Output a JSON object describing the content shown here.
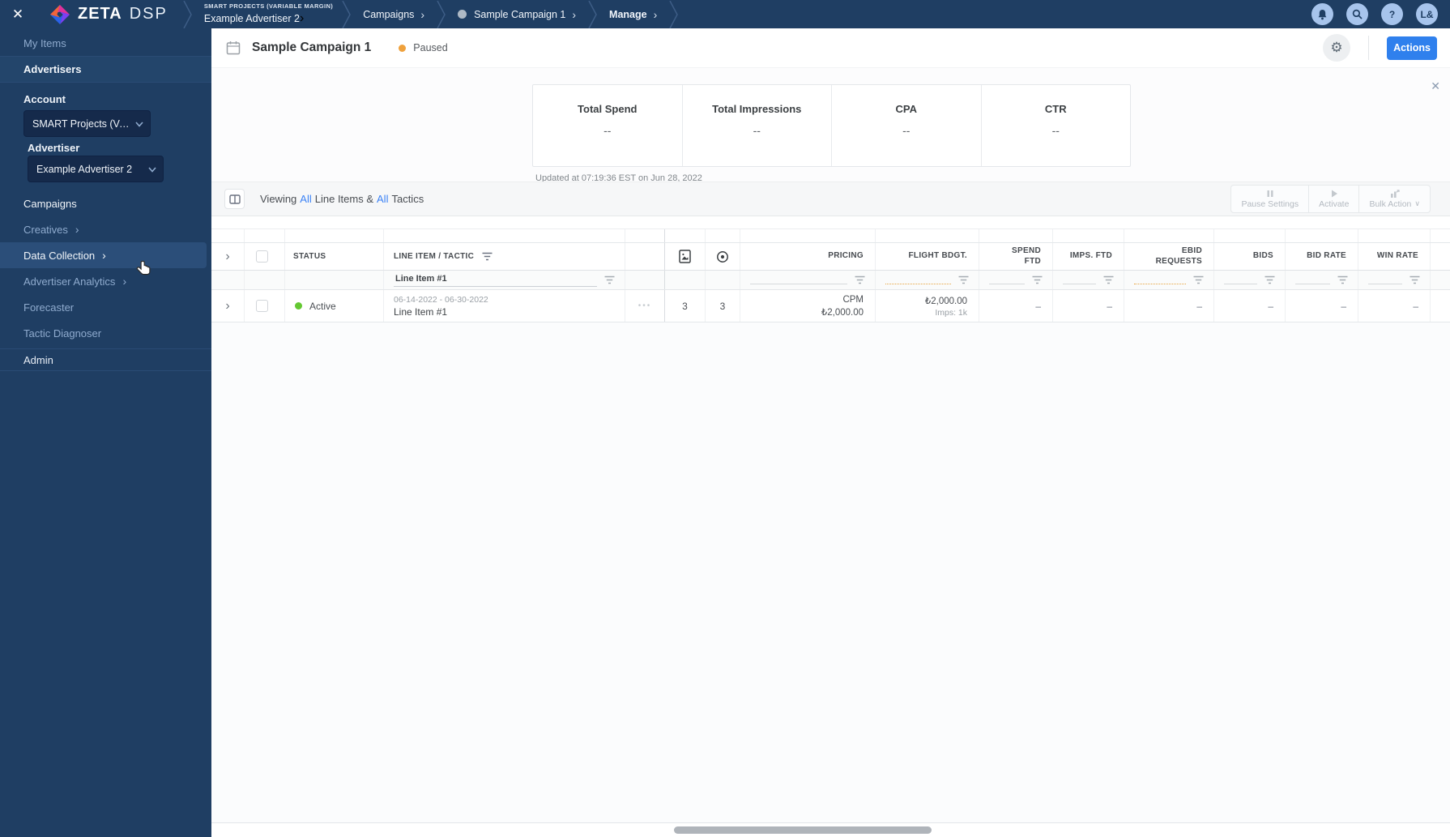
{
  "app": {
    "name_primary": "ZETA",
    "name_secondary": "DSP"
  },
  "topbar": {
    "breadcrumb": {
      "account_eyebrow": "SMART PROJECTS (VARIABLE MARGIN)",
      "advertiser": "Example Advertiser 2",
      "campaigns": "Campaigns",
      "campaign": "Sample Campaign 1",
      "manage": "Manage"
    },
    "avatar_initials": "L&"
  },
  "sidebar": {
    "my_items": "My Items",
    "advertisers": "Advertisers",
    "account_label": "Account",
    "account_value": "SMART Projects (Variable Margin)",
    "advertiser_label": "Advertiser",
    "advertiser_value": "Example Advertiser 2",
    "nav": [
      {
        "label": "Campaigns"
      },
      {
        "label": "Creatives"
      },
      {
        "label": "Data Collection"
      },
      {
        "label": "Advertiser Analytics"
      },
      {
        "label": "Forecaster"
      },
      {
        "label": "Tactic Diagnoser"
      }
    ],
    "admin": "Admin"
  },
  "header": {
    "title": "Sample Campaign 1",
    "status": "Paused",
    "actions_label": "Actions"
  },
  "stats": {
    "cards": [
      {
        "label": "Total Spend",
        "value": "--"
      },
      {
        "label": "Total Impressions",
        "value": "--"
      },
      {
        "label": "CPA",
        "value": "--"
      },
      {
        "label": "CTR",
        "value": "--"
      }
    ],
    "updated": "Updated at 07:19:36 EST on Jun 28, 2022"
  },
  "toolbar": {
    "viewing_1": "Viewing",
    "all_1": "All",
    "viewing_2": "Line Items &",
    "all_2": "All",
    "viewing_3": "Tactics",
    "pause_settings": "Pause Settings",
    "activate": "Activate",
    "bulk_action": "Bulk Action"
  },
  "table": {
    "headers": {
      "status": "STATUS",
      "line_item": "LINE ITEM / TACTIC",
      "pricing": "PRICING",
      "flight": "FLIGHT BDGT.",
      "spend_ftd": "SPEND\nFTD",
      "imps_ftd": "IMPS. FTD",
      "ebid": "EBID\nREQUESTS",
      "bids": "BIDS",
      "bid_rate": "BID RATE",
      "win_rate": "WIN RATE"
    },
    "filters": {
      "line_item_value": "Line Item #1"
    },
    "row": {
      "status": "Active",
      "dates": "06-14-2022 - 06-30-2022",
      "name": "Line Item #1",
      "creatives_count": "3",
      "tactics_count": "3",
      "pricing_type": "CPM",
      "pricing_value": "₺2,000.00",
      "flight_budget": "₺2,000.00",
      "flight_imps": "Imps: 1k",
      "dash": "–"
    }
  },
  "icons": {
    "close-icon": "✕",
    "bell-icon": "bell",
    "search-icon": "magnifier",
    "help-icon": "?",
    "gear-icon": "gear",
    "calendar-icon": "calendar",
    "columns-icon": "column-toggle",
    "filter-icon": "filter-lines",
    "creative-icon": "image-file",
    "tactic-icon": "target",
    "pause-icon": "pause-bars",
    "play-icon": "play-triangle",
    "bulk-icon": "bulk-chart"
  },
  "colors": {
    "navy": "#1F3E63",
    "accent": "#2F80ED",
    "paused_dot": "#EFA13C",
    "active_dot": "#64C832",
    "link_blue": "#3B82F6"
  }
}
